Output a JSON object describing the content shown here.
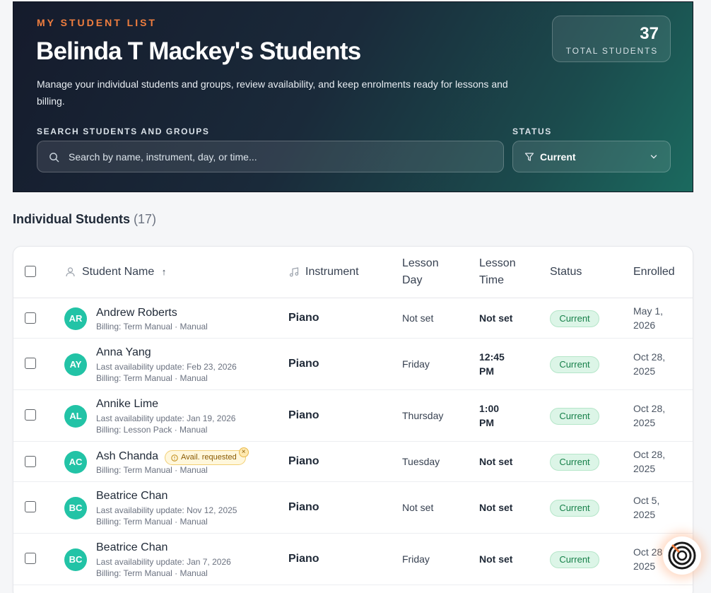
{
  "hero": {
    "eyebrow": "MY STUDENT LIST",
    "title": "Belinda T Mackey's Students",
    "description": "Manage your individual students and groups, review availability, and keep enrolments ready for lessons and billing.",
    "total_count": "37",
    "total_label": "TOTAL STUDENTS",
    "search_label": "SEARCH STUDENTS AND GROUPS",
    "search_placeholder": "Search by name, instrument, day, or time...",
    "status_label": "STATUS",
    "status_value": "Current"
  },
  "section": {
    "title": "Individual Students",
    "count": "(17)"
  },
  "table": {
    "headers": {
      "student_name": "Student Name",
      "sort_indicator": "↑",
      "instrument": "Instrument",
      "lesson_day": "Lesson Day",
      "lesson_time": "Lesson Time",
      "status": "Status",
      "enrolled": "Enrolled"
    },
    "rows": [
      {
        "initials": "AR",
        "name": "Andrew Roberts",
        "sub1": "Billing: Term Manual · Manual",
        "sub2": "",
        "instrument": "Piano",
        "day": "Not set",
        "time": "Not set",
        "status": "Current",
        "enrolled": "May 1, 2026"
      },
      {
        "initials": "AY",
        "name": "Anna Yang",
        "sub1": "Last availability update: Feb 23, 2026",
        "sub2": "Billing: Term Manual · Manual",
        "instrument": "Piano",
        "day": "Friday",
        "time": "12:45 PM",
        "status": "Current",
        "enrolled": "Oct 28, 2025"
      },
      {
        "initials": "AL",
        "name": "Annike Lime",
        "sub1": "Last availability update: Jan 19, 2026",
        "sub2": "Billing: Lesson Pack · Manual",
        "instrument": "Piano",
        "day": "Thursday",
        "time": "1:00 PM",
        "status": "Current",
        "enrolled": "Oct 28, 2025"
      },
      {
        "initials": "AC",
        "name": "Ash Chanda",
        "badge": "Avail. requested",
        "badge_close": "×",
        "sub1": "Billing: Term Manual · Manual",
        "sub2": "",
        "instrument": "Piano",
        "day": "Tuesday",
        "time": "Not set",
        "status": "Current",
        "enrolled": "Oct 28, 2025"
      },
      {
        "initials": "BC",
        "name": "Beatrice Chan",
        "sub1": "Last availability update: Nov 12, 2025",
        "sub2": "Billing: Term Manual · Manual",
        "instrument": "Piano",
        "day": "Not set",
        "time": "Not set",
        "status": "Current",
        "enrolled": "Oct 5, 2025"
      },
      {
        "initials": "BC",
        "name": "Beatrice Chan",
        "sub1": "Last availability update: Jan 7, 2026",
        "sub2": "Billing: Term Manual · Manual",
        "instrument": "Piano",
        "day": "Friday",
        "time": "Not set",
        "status": "Current",
        "enrolled": "Oct 28, 2025"
      }
    ]
  },
  "icons": {
    "search": "search-icon",
    "filter": "filter-icon",
    "chevron": "chevron-down-icon",
    "user": "user-icon",
    "music": "music-note-icon",
    "alert": "alert-circle-icon",
    "assistant": "assistant-logo-icon"
  },
  "colors": {
    "accent": "#f07e3f",
    "avatar": "#22c3a6",
    "status_current_bg": "#dcf5e7",
    "status_current_text": "#17804a"
  }
}
